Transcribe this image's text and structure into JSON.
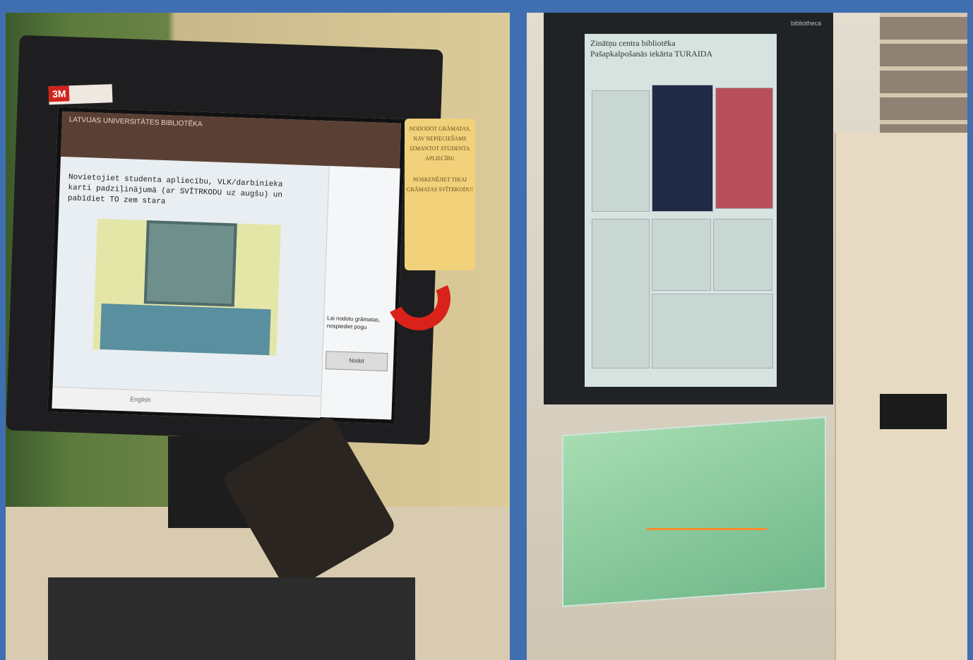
{
  "left_kiosk": {
    "monitor_brand": "3M",
    "screen": {
      "header_title": "LATVIJAS UNIVERSITĀTES BIBLIOTĒKA",
      "instruction": "Novietojiet studenta apliecību, VLK/darbinieka karti padziļinājumā (ar SVĪTRKODU uz augšu) un pabīdiet TO zem stara",
      "prompt": "Lai nodotu grāmatas, nospiediet pogu",
      "next_button": "Nodot",
      "language": "English"
    },
    "sticky_note": {
      "line1": "NODODOT GRĀMATAS, NAV NEPIECIEŠAMS IZMANTOT STUDENTA APLIECĪBU",
      "line2": "NOSKENĒJIET TIKAI GRĀMATAS SVĪTRKODU!"
    }
  },
  "right_kiosk": {
    "brand": "bibliotheca",
    "screen": {
      "header_line1": "Zinātņu centra bibliotēka",
      "header_line2": "Pašapkalpošanās iekārta TURAIDA"
    }
  },
  "colors": {
    "frame": "#3f6fb0",
    "note": "#f1d17a",
    "arrow": "#d8221a"
  }
}
